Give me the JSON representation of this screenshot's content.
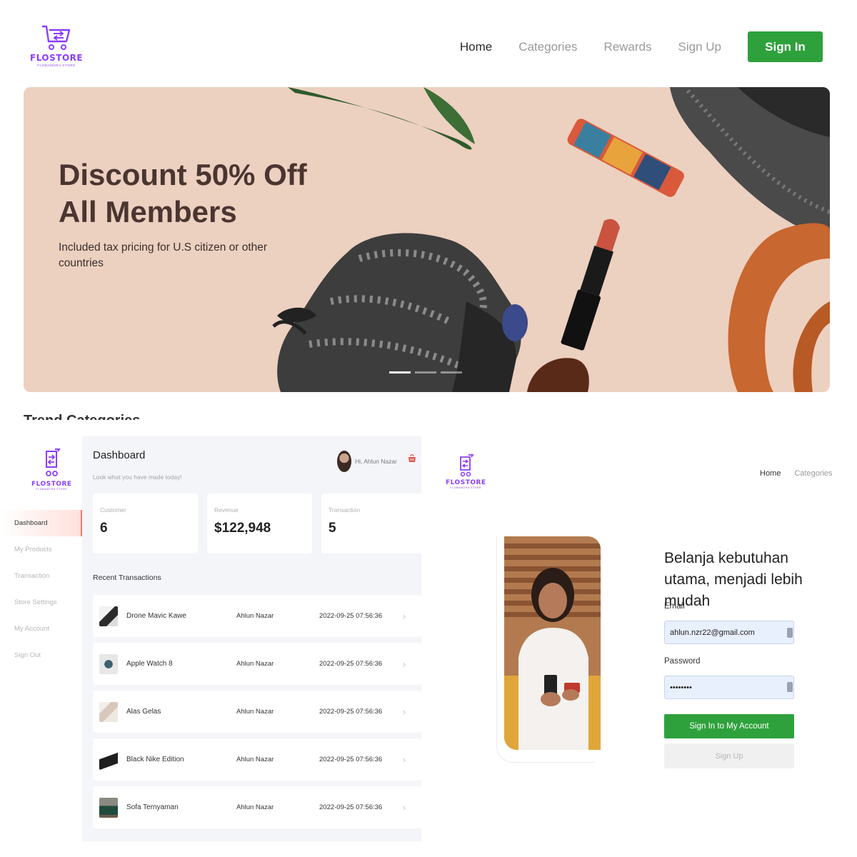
{
  "landing": {
    "logo": {
      "name": "FLOSTORE",
      "tagline": "FLOBAMORA STORE"
    },
    "nav": {
      "links": [
        "Home",
        "Categories",
        "Rewards",
        "Sign Up"
      ],
      "sign_in": "Sign In"
    },
    "hero": {
      "title_line1": "Discount 50% Off",
      "title_line2": "All Members",
      "subtitle": "Included tax pricing for U.S citizen or other countries"
    },
    "section_title": "Trend Categories"
  },
  "dashboard": {
    "logo": {
      "name": "FLOSTORE",
      "tagline": "FLOBAMORA STORE"
    },
    "sidebar": [
      "Dashboard",
      "My Products",
      "Transaction",
      "Store Settings",
      "My Account",
      "Sign Out"
    ],
    "title": "Dashboard",
    "subtitle": "Look what you have made today!",
    "greeting": "Hi, Ahlun Nazar",
    "stats": [
      {
        "label": "Customer",
        "value": "6"
      },
      {
        "label": "Revenue",
        "value": "$122,948"
      },
      {
        "label": "Transaction",
        "value": "5"
      }
    ],
    "recent_title": "Recent Transactions",
    "transactions": [
      {
        "name": "Drone Mavic Kawe",
        "user": "Ahlun Nazar",
        "date": "2022-09-25 07:56:36"
      },
      {
        "name": "Apple Watch 8",
        "user": "Ahlun Nazar",
        "date": "2022-09-25 07:56:36"
      },
      {
        "name": "Alas Gelas",
        "user": "Ahlun Nazar",
        "date": "2022-09-25 07:56:36"
      },
      {
        "name": "Black Nike Edition",
        "user": "Ahlun Nazar",
        "date": "2022-09-25 07:56:36"
      },
      {
        "name": "Sofa Ternyaman",
        "user": "Ahlun Nazar",
        "date": "2022-09-25 07:56:36"
      }
    ]
  },
  "signin": {
    "logo": {
      "name": "FLOSTORE",
      "tagline": "FLOBAMORA STORE"
    },
    "nav": [
      "Home",
      "Categories"
    ],
    "heading": "Belanja kebutuhan utama, menjadi lebih mudah",
    "email_label": "Email",
    "email_value": "ahlun.nzr22@gmail.com",
    "password_label": "Password",
    "password_value": "••••••••",
    "primary_button": "Sign In to My Account",
    "secondary_button": "Sign Up"
  },
  "colors": {
    "brand": "#8b3dff",
    "accent_green": "#2ea13c",
    "hero_bg": "#ecd0c0",
    "active_marker": "#f27c6c"
  },
  "icons": [
    "cart-logo-icon",
    "shopping-basket-icon",
    "chevron-right-icon",
    "password-manager-key-icon"
  ]
}
